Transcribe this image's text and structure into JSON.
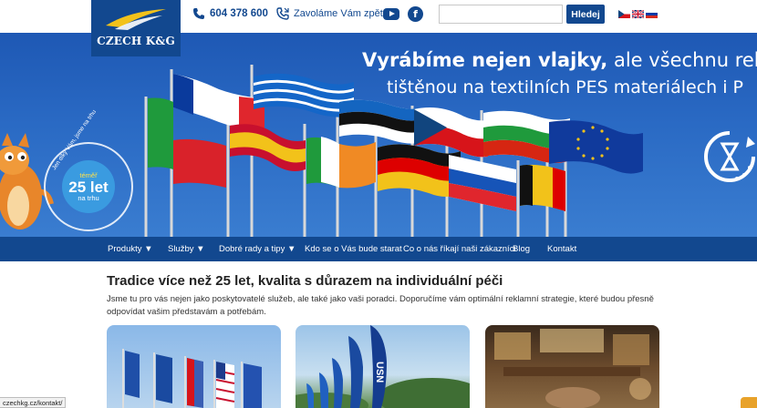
{
  "brand": {
    "name": "CZECH K&G"
  },
  "header": {
    "phone": "604 378 600",
    "callback": "Zavoláme Vám zpět",
    "search_placeholder": "",
    "search_button": "Hledej",
    "languages": [
      "cz-flag-icon",
      "uk-flag-icon",
      "ru-flag-icon"
    ],
    "social": [
      "youtube-icon",
      "facebook-icon"
    ],
    "facebook_glyph": "f"
  },
  "banner": {
    "line1_bold": "Vyrábíme nejen vlajky,",
    "line1_rest": " ale všechnu rekla",
    "line2": "tištěnou na textilních PES materiálech i P",
    "badge": {
      "arc": "Jen díky Vám, jsme na trhu",
      "small": "téměř",
      "big": "25 let",
      "bottom": "na trhu"
    }
  },
  "nav": {
    "items": [
      {
        "label": "Produkty ▼"
      },
      {
        "label": "Služby ▼"
      },
      {
        "label": "Dobré rady a tipy ▼"
      },
      {
        "label": "Kdo se o Vás bude starat"
      },
      {
        "label": "Co o nás říkají naši zákazníci"
      },
      {
        "label": "Blog"
      },
      {
        "label": "Kontakt"
      }
    ]
  },
  "content": {
    "heading": "Tradice více než 25 let, kvalita s důrazem na individuální péči",
    "intro": "Jsme tu pro vás nejen jako poskytovatelé služeb, ale také jako vaši poradci. Doporučíme vám optimální reklamní strategie, které budou přesně odpovídat vašim představám a potřebám.",
    "card2_text": "USN"
  },
  "status": {
    "url": "czechkg.cz/kontakt/"
  },
  "colors": {
    "brand_blue": "#12488f",
    "accent_yellow": "#f2c21a"
  }
}
